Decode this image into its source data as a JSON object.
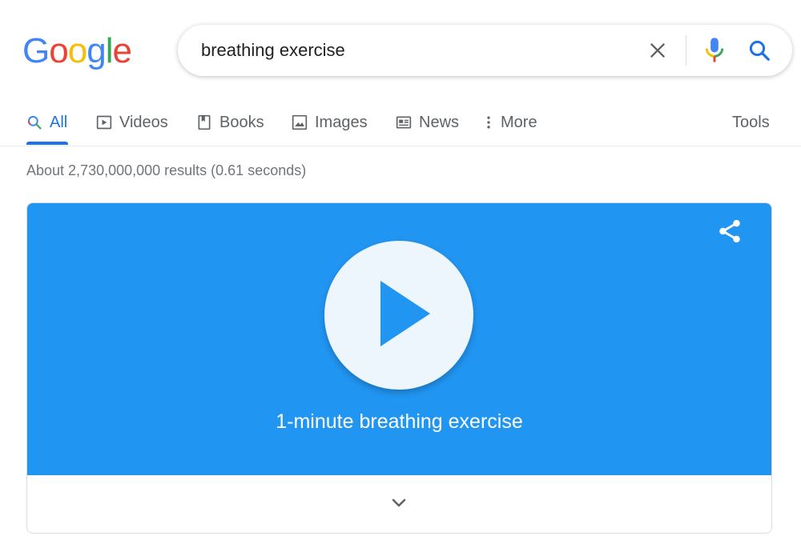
{
  "logo": {
    "letters": [
      "G",
      "o",
      "o",
      "g",
      "l",
      "e"
    ],
    "colors": [
      "#4285F4",
      "#EA4335",
      "#FBBC05",
      "#4285F4",
      "#34A853",
      "#EA4335"
    ]
  },
  "search": {
    "query": "breathing exercise",
    "clear_icon": "close-icon",
    "mic_icon": "mic-icon",
    "search_icon": "search-icon"
  },
  "tabs": [
    {
      "label": "All",
      "icon": "search-icon",
      "active": true
    },
    {
      "label": "Videos",
      "icon": "play-box-icon",
      "active": false
    },
    {
      "label": "Books",
      "icon": "book-icon",
      "active": false
    },
    {
      "label": "Images",
      "icon": "image-icon",
      "active": false
    },
    {
      "label": "News",
      "icon": "news-icon",
      "active": false
    },
    {
      "label": "More",
      "icon": "more-vert-icon",
      "active": false
    }
  ],
  "tools_label": "Tools",
  "result_stats": "About 2,730,000,000 results (0.61 seconds)",
  "breathing_card": {
    "title": "1-minute breathing exercise",
    "background_color": "#2195f2",
    "share_icon": "share-icon",
    "play_icon": "play-icon",
    "expand_icon": "chevron-down-icon"
  },
  "colors": {
    "accent": "#1a73e8",
    "text_secondary": "#5f6368"
  }
}
